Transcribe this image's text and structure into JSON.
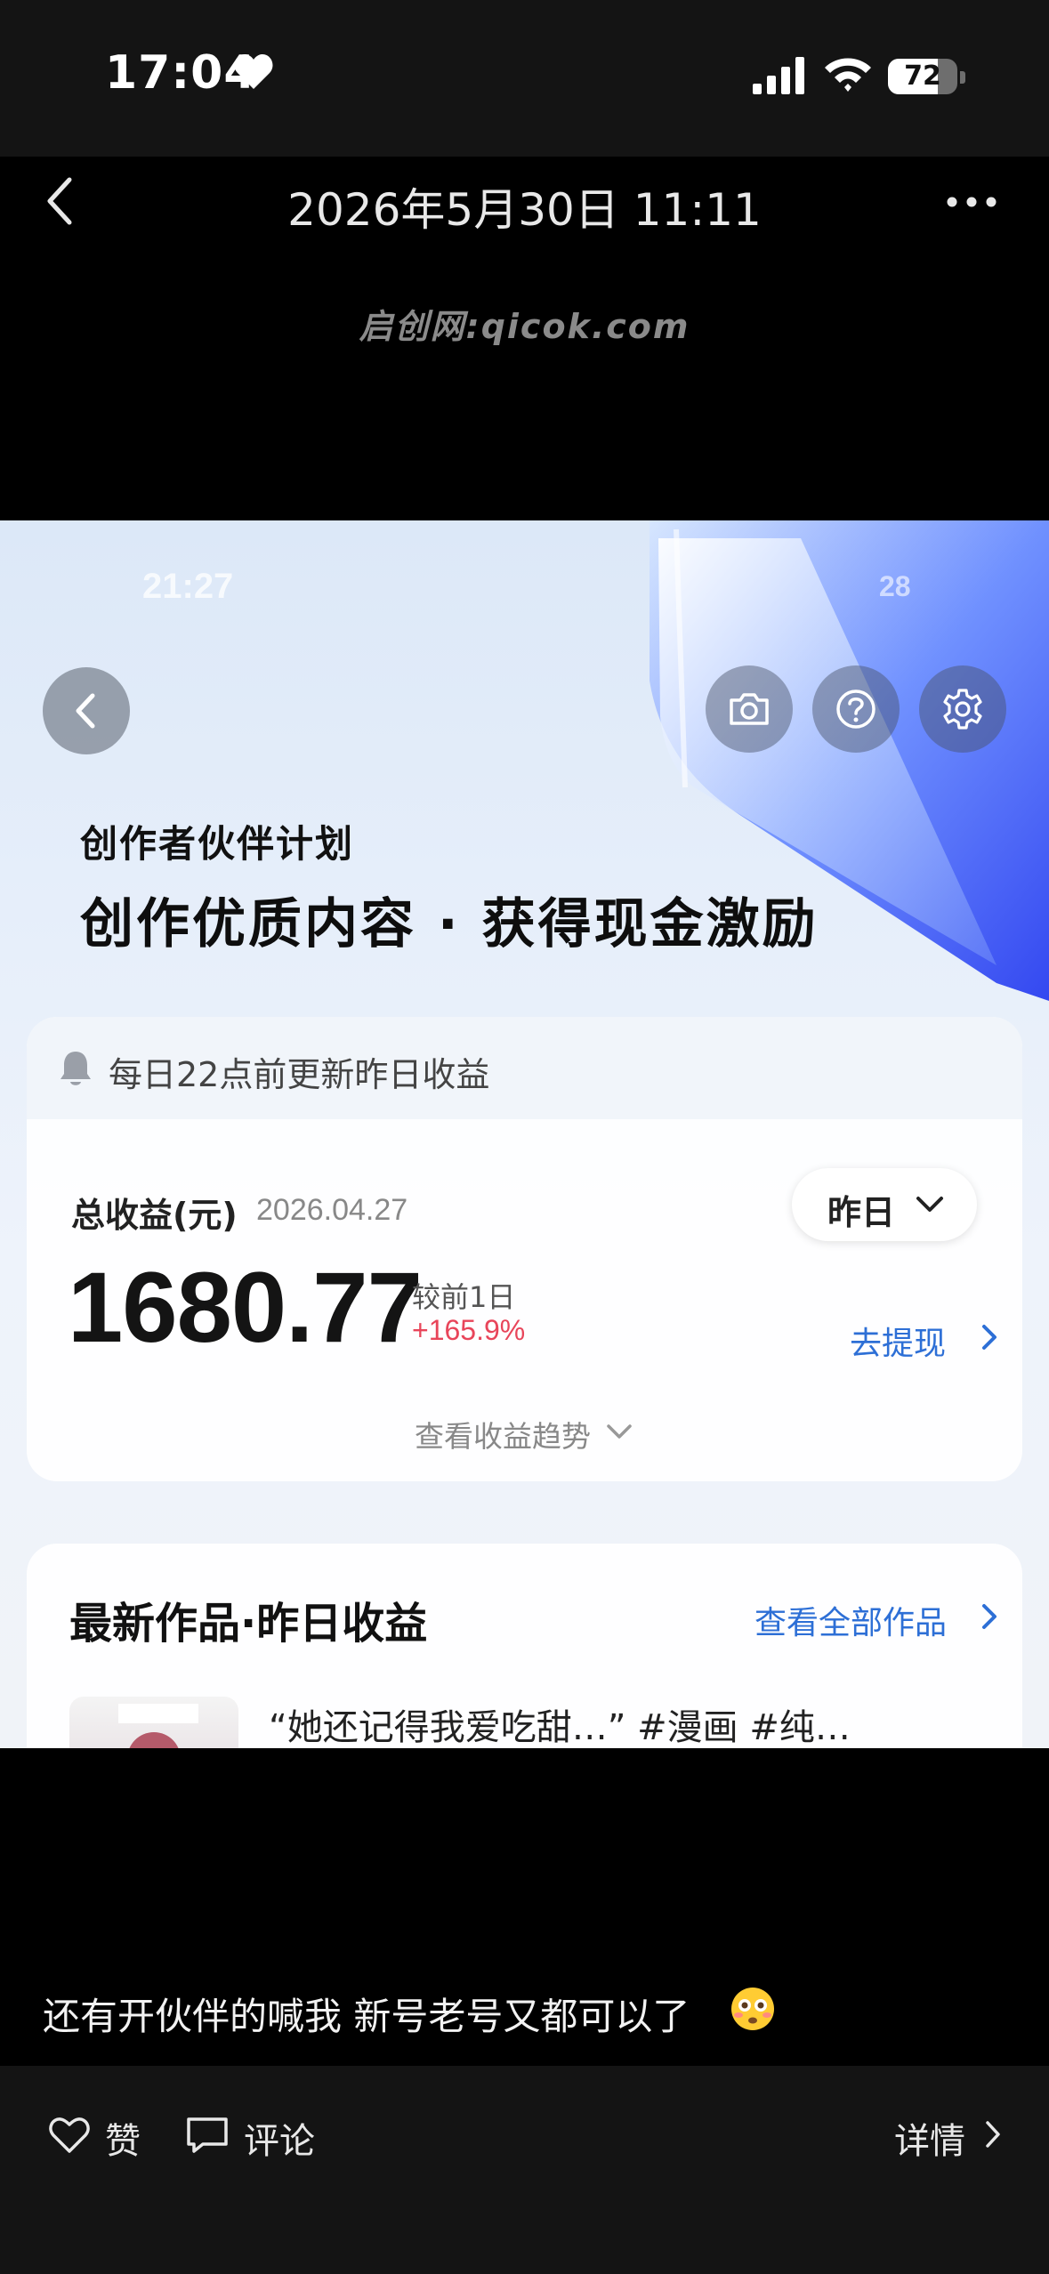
{
  "status_bar": {
    "time": "17:04",
    "battery": "72",
    "battery_level": 0.72
  },
  "header": {
    "title": "2026年5月30日 11:11"
  },
  "watermark": "启创网:qicok.com",
  "embedded": {
    "status_time": "21:27",
    "status_battery": "28",
    "plan_title": "创作者伙伴计划",
    "plan_slogan": "创作优质内容 · 获得现金激励",
    "notice": "每日22点前更新昨日收益",
    "total_label": "总收益(元)",
    "total_date": "2026.04.27",
    "period": "昨日",
    "total_amount": "1680.77",
    "compare_label": "较前1日",
    "compare_value": "+165.9%",
    "withdraw": "去提现",
    "trend": "查看收益趋势",
    "works_title": "最新作品·昨日收益",
    "works_all": "查看全部作品",
    "work_title": "“她还记得我爱吃甜…” #漫画 #纯…"
  },
  "caption": "还有开伙伴的喊我 新号老号又都可以了",
  "bottom_bar": {
    "like": "赞",
    "comment": "评论",
    "detail": "详情"
  },
  "colors": {
    "accent_blue": "#2d6fd6",
    "increase_red": "#e8455a"
  },
  "icons": [
    "heart-icon",
    "signal-icon",
    "wifi-icon",
    "battery-icon",
    "back-icon",
    "more-icon",
    "camera-icon",
    "help-icon",
    "settings-icon",
    "bell-icon",
    "chevron-down-icon",
    "chevron-right-icon",
    "flushed-face-emoji",
    "like-icon",
    "comment-icon"
  ]
}
